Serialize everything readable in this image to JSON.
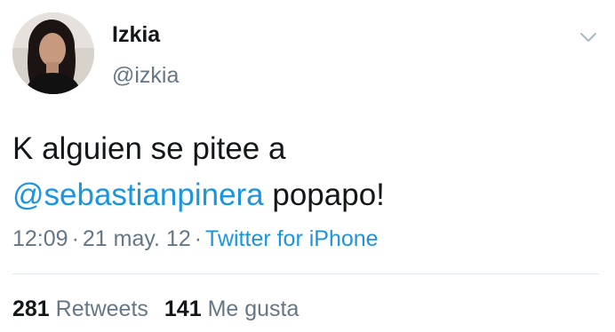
{
  "tweet": {
    "author": {
      "name": "Izkia",
      "handle": "@izkia"
    },
    "text": {
      "line1": "K alguien se pitee a",
      "mention": "@sebastianpinera",
      "after_mention": " popapo!"
    },
    "meta": {
      "time": "12:09",
      "separator": "·",
      "date": "21 may. 12",
      "source": "Twitter for iPhone"
    },
    "stats": {
      "retweets_count": "281",
      "retweets_label": "Retweets",
      "likes_count": "141",
      "likes_label": "Me gusta"
    },
    "icons": {
      "menu": "chevron-down-icon",
      "avatar": "avatar"
    },
    "colors": {
      "link": "#1b95e0",
      "secondary_text": "#657786",
      "primary_text": "#14171a",
      "divider": "#e1e8ed"
    }
  }
}
